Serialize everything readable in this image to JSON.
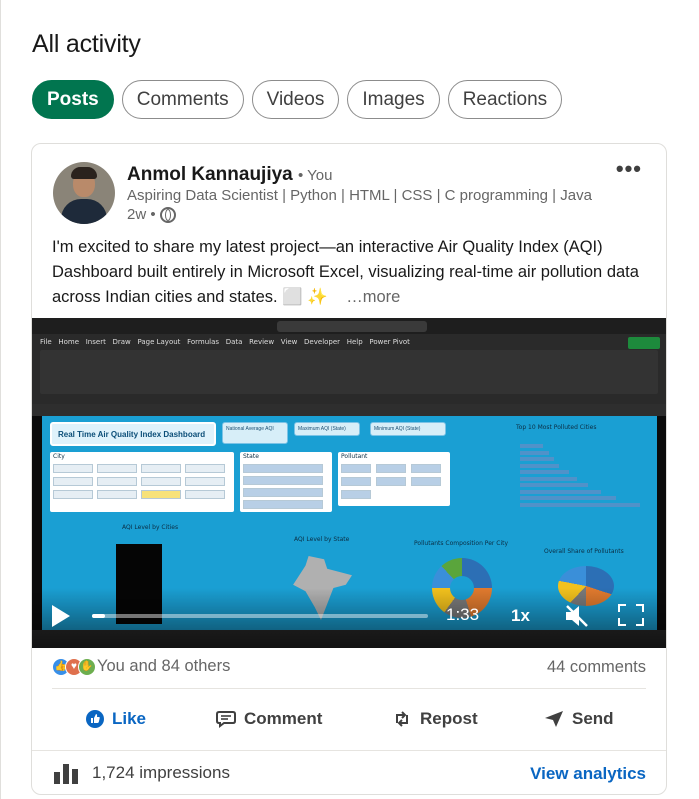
{
  "page": {
    "title": "All activity"
  },
  "filters": [
    "Posts",
    "Comments",
    "Videos",
    "Images",
    "Reactions"
  ],
  "filters_active": "Posts",
  "post": {
    "author": "Anmol Kannaujiya",
    "you_tag": "• You",
    "headline": "Aspiring Data Scientist | Python | HTML | CSS | C programming | Java",
    "age": "2w •",
    "visibility_icon": "globe-icon",
    "menu_icon": "more-horizontal-icon",
    "text": "I'm excited to share my latest project—an interactive Air Quality Index (AQI) Dashboard built entirely in Microsoft Excel, visualizing real-time air pollution data across Indian cities and states. ⬜ ✨",
    "more_label": "…more",
    "video": {
      "dashboard_title": "Real Time Air Quality Index Dashboard",
      "kpi_1": "National Average AQI",
      "kpi_2": "Maximum AQI (State)",
      "kpi_3": "Minimum AQI (State)",
      "top10_title": "Top 10 Most Polluted Cities",
      "aqi_cities_title": "AQI Level by Cities",
      "aqi_state_title": "AQI Level by State",
      "pollutant_city_title": "Pollutants Composition Per City",
      "pollutant_share_title": "Overall Share of Pollutants",
      "slicer_city": "City",
      "slicer_state": "State",
      "slicer_pollutant": "Pollutant",
      "time": "1:33",
      "speed": "1x",
      "progress_fraction": 0.04
    },
    "reactions_text": "You and 84 others",
    "comments_text": "44 comments",
    "actions": {
      "like": "Like",
      "comment": "Comment",
      "repost": "Repost",
      "send": "Send"
    },
    "impressions": "1,724 impressions",
    "view_analytics": "View analytics"
  },
  "colors": {
    "accent": "#01754f",
    "link": "#0a66c2",
    "dashboard_bg": "#1a9fd3"
  }
}
